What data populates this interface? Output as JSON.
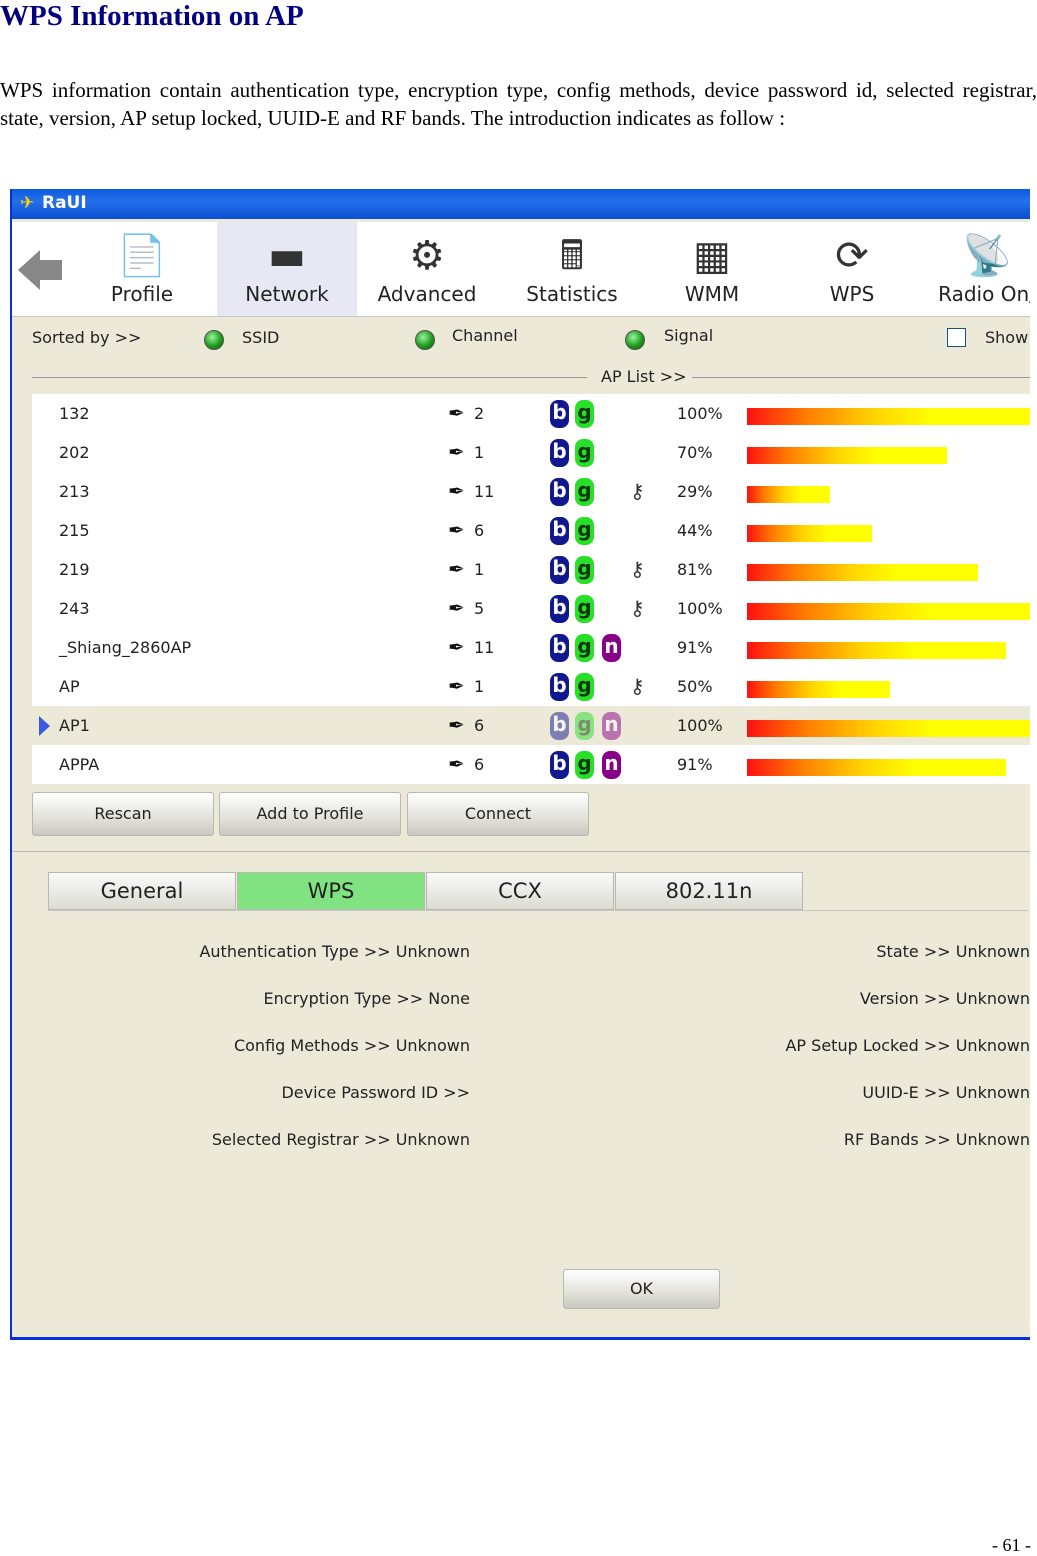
{
  "doc": {
    "title": "WPS Information on AP",
    "paragraph": "WPS information contain authentication type, encryption type, config methods, device password id, selected registrar, state, version, AP setup locked, UUID-E and RF bands. The introduction indicates as follow :",
    "page_number": "- 61 -"
  },
  "window": {
    "title": "RaUI"
  },
  "toolbar": {
    "items": [
      {
        "label": "Profile",
        "icon": "profile-icon"
      },
      {
        "label": "Network",
        "icon": "network-icon",
        "active": true
      },
      {
        "label": "Advanced",
        "icon": "advanced-icon"
      },
      {
        "label": "Statistics",
        "icon": "statistics-icon"
      },
      {
        "label": "WMM",
        "icon": "wmm-icon"
      },
      {
        "label": "WPS",
        "icon": "wps-icon"
      },
      {
        "label": "Radio On/",
        "icon": "radio-icon"
      }
    ]
  },
  "sort": {
    "label": "Sorted by >>",
    "ssid": "SSID",
    "channel": "Channel",
    "signal": "Signal",
    "show": "Show"
  },
  "ap_list": {
    "header": "AP List >>",
    "badges": {
      "b": "b",
      "g": "g",
      "n": "n"
    },
    "rows": [
      {
        "ssid": "132",
        "channel": "2",
        "n": false,
        "secured": false,
        "signal": "100%",
        "signal_value": 100
      },
      {
        "ssid": "202",
        "channel": "1",
        "n": false,
        "secured": false,
        "signal": "70%",
        "signal_value": 70
      },
      {
        "ssid": "213",
        "channel": "11",
        "n": false,
        "secured": true,
        "signal": "29%",
        "signal_value": 29
      },
      {
        "ssid": "215",
        "channel": "6",
        "n": false,
        "secured": false,
        "signal": "44%",
        "signal_value": 44
      },
      {
        "ssid": "219",
        "channel": "1",
        "n": false,
        "secured": true,
        "signal": "81%",
        "signal_value": 81
      },
      {
        "ssid": "243",
        "channel": "5",
        "n": false,
        "secured": true,
        "signal": "100%",
        "signal_value": 100
      },
      {
        "ssid": "_Shiang_2860AP",
        "channel": "11",
        "n": true,
        "secured": false,
        "signal": "91%",
        "signal_value": 91
      },
      {
        "ssid": "AP",
        "channel": "1",
        "n": false,
        "secured": true,
        "signal": "50%",
        "signal_value": 50
      },
      {
        "ssid": "AP1",
        "channel": "6",
        "n": true,
        "secured": false,
        "signal": "100%",
        "signal_value": 100,
        "selected": true
      },
      {
        "ssid": "APPA",
        "channel": "6",
        "n": true,
        "secured": false,
        "signal": "91%",
        "signal_value": 91
      }
    ]
  },
  "buttons": {
    "rescan": "Rescan",
    "add_profile": "Add to Profile",
    "connect": "Connect",
    "ok": "OK"
  },
  "tabs": [
    {
      "label": "General"
    },
    {
      "label": "WPS",
      "active": true
    },
    {
      "label": "CCX"
    },
    {
      "label": "802.11n"
    }
  ],
  "wps_info": {
    "left": [
      "Authentication Type >> Unknown",
      "Encryption Type >> None",
      "Config Methods >> Unknown",
      "Device Password ID >>",
      "Selected Registrar >> Unknown"
    ],
    "right": [
      "State >> Unknown",
      "Version >> Unknown",
      "AP Setup Locked >> Unknown",
      "UUID-E >> Unknown",
      "RF Bands >> Unknown"
    ]
  }
}
